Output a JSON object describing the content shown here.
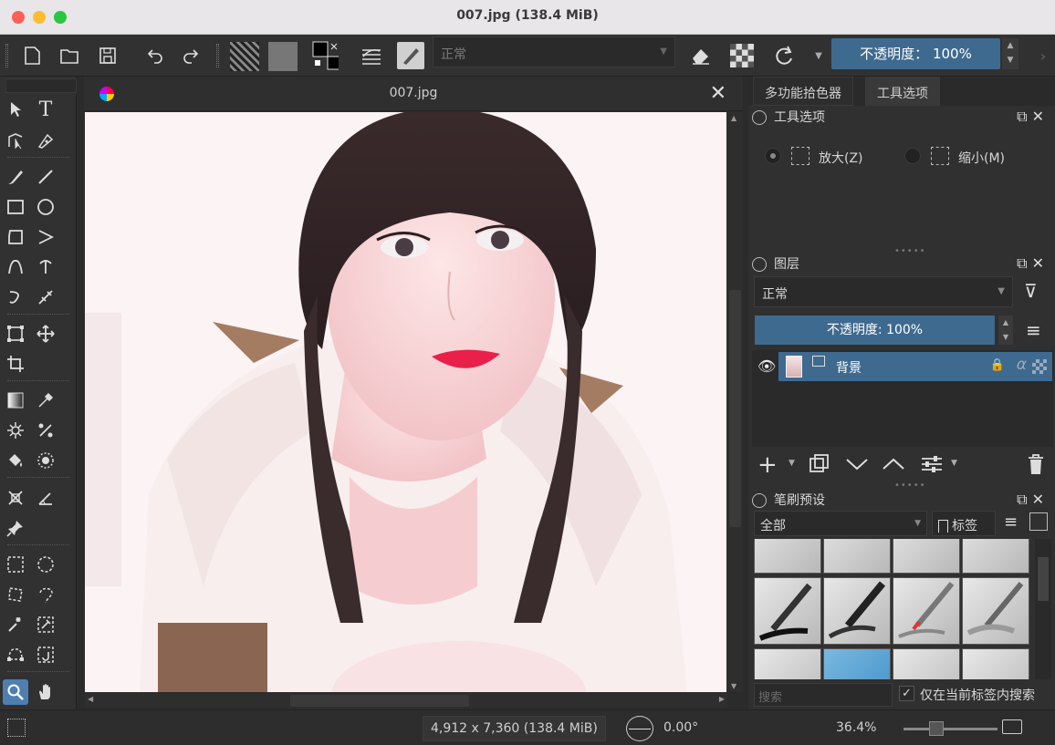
{
  "window": {
    "title": "007.jpg (138.4 MiB)"
  },
  "toolbar": {
    "blend_mode": "正常",
    "opacity_label": "不透明度：  100%"
  },
  "document": {
    "tab_title": "007.jpg"
  },
  "right_tabs": [
    "多功能拾色器",
    "工具选项"
  ],
  "tool_options": {
    "header": "工具选项",
    "zoom_in": "放大(Z)",
    "zoom_out": "缩小(M)"
  },
  "layers": {
    "header": "图层",
    "mode": "正常",
    "opacity": "不透明度: 100%",
    "items": [
      {
        "name": "背景"
      }
    ]
  },
  "brushes": {
    "header": "笔刷预设",
    "filter": "全部",
    "tag_button": "标签",
    "search_placeholder": "搜索",
    "search_in_tag": "仅在当前标签内搜索"
  },
  "status": {
    "dimensions": "4,912 x 7,360 (138.4 MiB)",
    "rotation": "0.00°",
    "zoom": "36.4%"
  }
}
